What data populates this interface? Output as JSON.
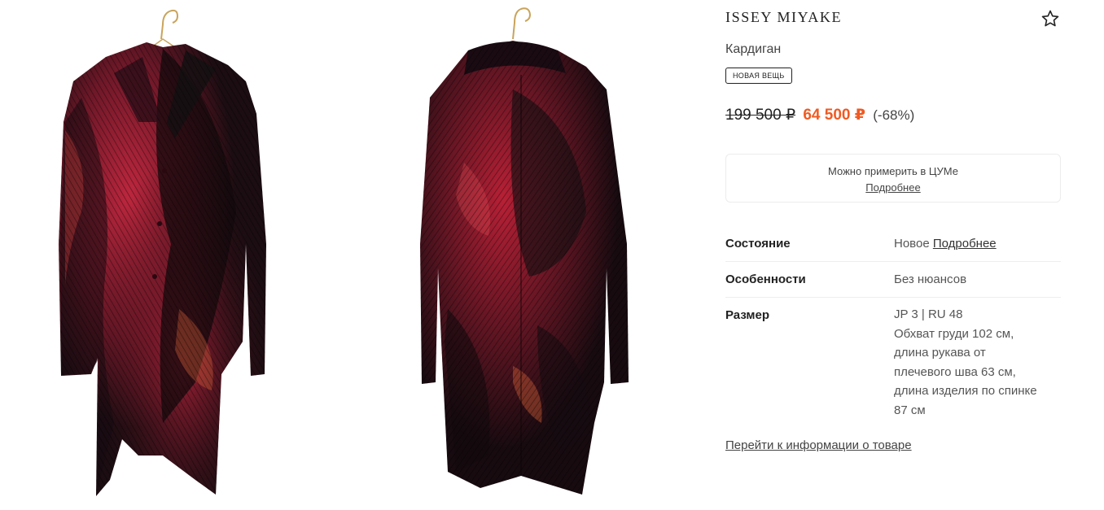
{
  "product": {
    "brand": "ISSEY MIYAKE",
    "type": "Кардиган",
    "badge": "НОВАЯ ВЕЩЬ",
    "favorite_icon": "star-outline-icon",
    "price_old": "199 500 ₽",
    "price_new": "64 500 ₽",
    "discount": "(-68%)",
    "colors": {
      "sale": "#f05a22",
      "text": "#222222"
    }
  },
  "gallery": {
    "images": [
      {
        "view": "front",
        "icon": "cardigan-front-photo"
      },
      {
        "view": "back",
        "icon": "cardigan-back-photo"
      }
    ]
  },
  "tryon": {
    "text": "Можно примерить в ЦУМе",
    "link": "Подробнее"
  },
  "specs": {
    "condition": {
      "label": "Состояние",
      "value": "Новое",
      "link": "Подробнее"
    },
    "features": {
      "label": "Особенности",
      "value": "Без нюансов"
    },
    "size": {
      "label": "Размер",
      "lines": [
        "JP 3 | RU 48",
        "Обхват груди 102 см,",
        "длина рукава от",
        "плечевого шва 63 см,",
        "длина изделия по спинке",
        "87 см"
      ]
    }
  },
  "more_link": "Перейти к информации о товаре"
}
